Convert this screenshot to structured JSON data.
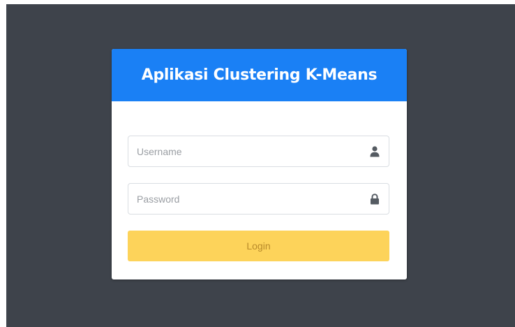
{
  "login": {
    "title": "Aplikasi Clustering K-Means",
    "username_placeholder": "Username",
    "password_placeholder": "Password",
    "login_label": "Login",
    "username_icon": "user-icon",
    "password_icon": "lock-icon"
  },
  "colors": {
    "header": "#1a80f5",
    "button": "#fdd35a",
    "background": "#3e434b"
  }
}
